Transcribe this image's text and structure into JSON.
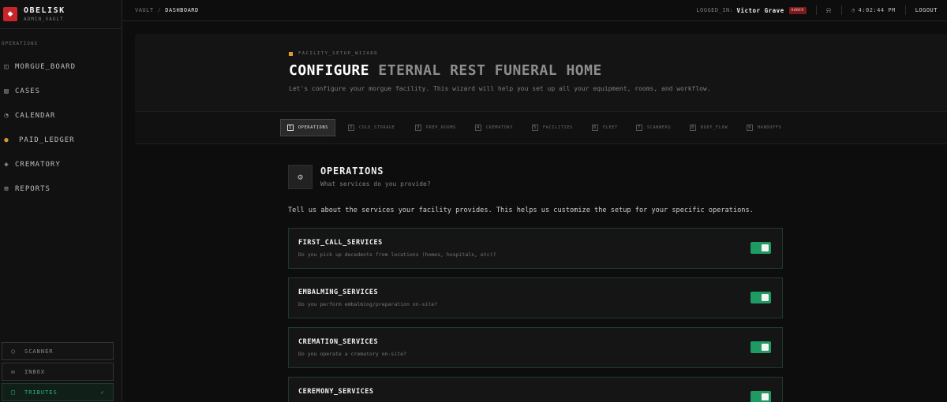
{
  "brand": {
    "name": "OBELISK",
    "subtitle": "ADMIN_VAULT"
  },
  "sidebar": {
    "section_label": "OPERATIONS",
    "items": [
      {
        "label": "MORGUE_BOARD",
        "icon": "columns-icon"
      },
      {
        "label": "CASES",
        "icon": "cases-icon"
      },
      {
        "label": "CALENDAR",
        "icon": "clock-icon"
      },
      {
        "label": "PAID_LEDGER",
        "icon": "money-bag-icon"
      },
      {
        "label": "CREMATORY",
        "icon": "flame-icon"
      },
      {
        "label": "REPORTS",
        "icon": "report-icon"
      }
    ],
    "bottom": [
      {
        "label": "SCANNER",
        "icon": "circle-icon"
      },
      {
        "label": "INBOX",
        "icon": "mail-icon"
      },
      {
        "label": "TRIBUTES",
        "icon": "chat-icon"
      }
    ]
  },
  "topbar": {
    "breadcrumb": [
      "VAULT",
      "/",
      "DASHBOARD"
    ],
    "logged_in_label": "LOGGED_IN:",
    "user_name": "Victor Grave",
    "role_badge": "OWNER",
    "time": "4:02:44 PM",
    "logout": "LOGOUT"
  },
  "wizard": {
    "eyebrow": "FACILITY_SETUP_WIZARD",
    "title_bold": "CONFIGURE",
    "title_rest": "ETERNAL REST FUNERAL HOME",
    "subtitle": "Let's configure your morgue facility. This wizard will help you set up all your equipment, rooms, and workflow.",
    "steps": [
      {
        "num": "1",
        "label": "OPERATIONS",
        "active": true
      },
      {
        "num": "2",
        "label": "COLD_STORAGE"
      },
      {
        "num": "3",
        "label": "PREP_ROOMS"
      },
      {
        "num": "4",
        "label": "CREMATORY"
      },
      {
        "num": "5",
        "label": "FACILITIES"
      },
      {
        "num": "6",
        "label": "FLEET"
      },
      {
        "num": "7",
        "label": "SCANNERS"
      },
      {
        "num": "8",
        "label": "BODY_FLOW"
      },
      {
        "num": "9",
        "label": "HANDOFFS"
      }
    ]
  },
  "section": {
    "title": "OPERATIONS",
    "subtitle": "What services do you provide?",
    "intro": "Tell us about the services your facility provides. This helps us customize the setup for your specific operations."
  },
  "services": [
    {
      "title": "FIRST_CALL_SERVICES",
      "desc": "Do you pick up decedents from locations (homes, hospitals, etc)?",
      "enabled": true
    },
    {
      "title": "EMBALMING_SERVICES",
      "desc": "Do you perform embalming/preparation on-site?",
      "enabled": true
    },
    {
      "title": "CREMATION_SERVICES",
      "desc": "Do you operate a crematory on-site?",
      "enabled": true
    },
    {
      "title": "CEREMONY_SERVICES",
      "desc": "",
      "enabled": true
    }
  ],
  "colors": {
    "accent_green": "#1f9a63",
    "brand_red": "#c8252b",
    "owner_badge": "#7a1a1d",
    "eyebrow_square": "#e39a2c"
  }
}
